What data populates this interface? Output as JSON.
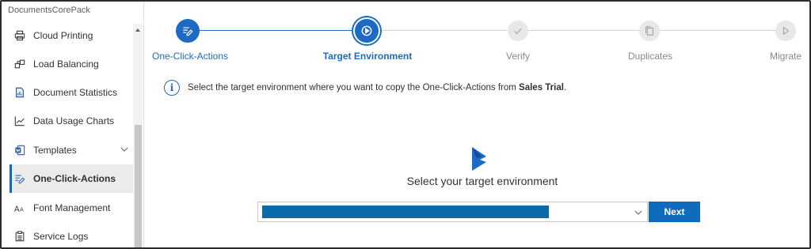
{
  "app": {
    "title": "DocumentsCorePack"
  },
  "sidebar": {
    "items": [
      {
        "label": "Cloud Printing",
        "icon": "printer-icon"
      },
      {
        "label": "Load Balancing",
        "icon": "load-balancing-icon"
      },
      {
        "label": "Document Statistics",
        "icon": "document-stats-icon"
      },
      {
        "label": "Data Usage Charts",
        "icon": "line-chart-icon"
      },
      {
        "label": "Templates",
        "icon": "word-template-icon",
        "expandable": true
      },
      {
        "label": "One-Click-Actions",
        "icon": "one-click-actions-icon",
        "active": true
      },
      {
        "label": "Font Management",
        "icon": "font-icon"
      },
      {
        "label": "Service Logs",
        "icon": "clipboard-icon"
      }
    ]
  },
  "stepper": {
    "steps": [
      {
        "label": "One-Click-Actions",
        "state": "done"
      },
      {
        "label": "Target Environment",
        "state": "current"
      },
      {
        "label": "Verify",
        "state": "pending"
      },
      {
        "label": "Duplicates",
        "state": "pending"
      },
      {
        "label": "Migrate",
        "state": "pending"
      }
    ]
  },
  "info": {
    "text": "Select the target environment where you want to copy the One-Click-Actions from ",
    "source": "Sales Trial",
    "suffix": "."
  },
  "main": {
    "prompt": "Select your target environment",
    "next_label": "Next"
  },
  "colors": {
    "accent": "#1d6ac6",
    "button": "#0f6cbd",
    "selected_fill": "#0b6aa8"
  }
}
